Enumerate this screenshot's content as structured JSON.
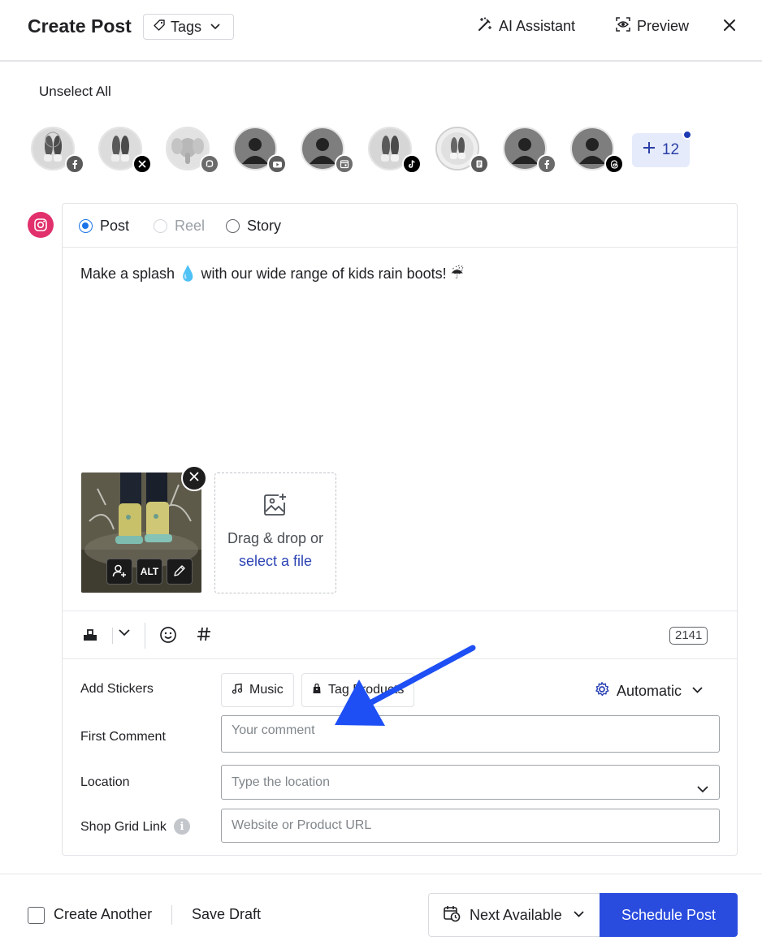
{
  "header": {
    "title": "Create Post",
    "tags_label": "Tags",
    "ai_assistant_label": "AI Assistant",
    "preview_label": "Preview"
  },
  "accounts": {
    "unselect_all_label": "Unselect All",
    "items": [
      {
        "avatar": "boots-photo",
        "network": "facebook-icon"
      },
      {
        "avatar": "boots-photo",
        "network": "x-icon"
      },
      {
        "avatar": "elephant-avatar",
        "network": "mastodon-icon"
      },
      {
        "avatar": "default-avatar",
        "network": "youtube-icon"
      },
      {
        "avatar": "default-avatar",
        "network": "google-business-icon"
      },
      {
        "avatar": "boots-photo",
        "network": "tiktok-icon"
      },
      {
        "avatar": "boots-photo",
        "network": "page-icon"
      },
      {
        "avatar": "default-avatar",
        "network": "facebook-icon"
      },
      {
        "avatar": "default-avatar",
        "network": "threads-icon"
      }
    ],
    "more_count": "12"
  },
  "editor": {
    "network": "instagram",
    "post_types": [
      {
        "label": "Post",
        "state": "checked"
      },
      {
        "label": "Reel",
        "state": "disabled"
      },
      {
        "label": "Story",
        "state": "unchecked"
      }
    ],
    "caption": "Make a splash 💧 with our wide range of kids rain boots! ☔",
    "media": {
      "alt_label": "ALT",
      "dropzone_text": "Drag & drop or",
      "dropzone_link": "select a file"
    },
    "char_count": "2141"
  },
  "options": {
    "stickers_label": "Add Stickers",
    "music_label": "Music",
    "tag_products_label": "Tag Products",
    "automatic_label": "Automatic",
    "first_comment_label": "First Comment",
    "first_comment_placeholder": "Your comment",
    "location_label": "Location",
    "location_placeholder": "Type the location",
    "shop_grid_label": "Shop Grid Link",
    "shop_grid_placeholder": "Website or Product URL"
  },
  "footer": {
    "create_another_label": "Create Another",
    "save_draft_label": "Save Draft",
    "next_available_label": "Next Available",
    "schedule_label": "Schedule Post"
  },
  "colors": {
    "primary": "#2a4cde",
    "link": "#2d44b4",
    "instagram": "#e1306c",
    "annotation_arrow": "#1d4ff5"
  }
}
